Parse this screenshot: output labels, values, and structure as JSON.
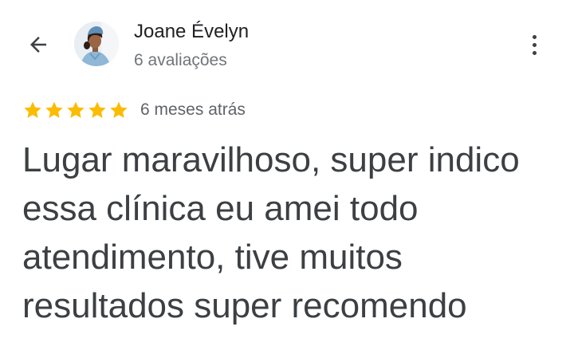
{
  "review": {
    "author_name": "Joane Évelyn",
    "author_review_count": "6 avaliações",
    "rating": 5,
    "rating_max": 5,
    "date": "6 meses atrás",
    "text": "Lugar maravilhoso, super indico essa clínica eu amei todo atendimento, tive muitos resultados super recomendo"
  },
  "icons": {
    "back": "arrow-left-icon",
    "more": "more-vert-icon",
    "star": "star-icon"
  },
  "colors": {
    "star": "#fbbc04",
    "text": "#3c4043",
    "secondary": "#70757a",
    "name": "#202124"
  }
}
